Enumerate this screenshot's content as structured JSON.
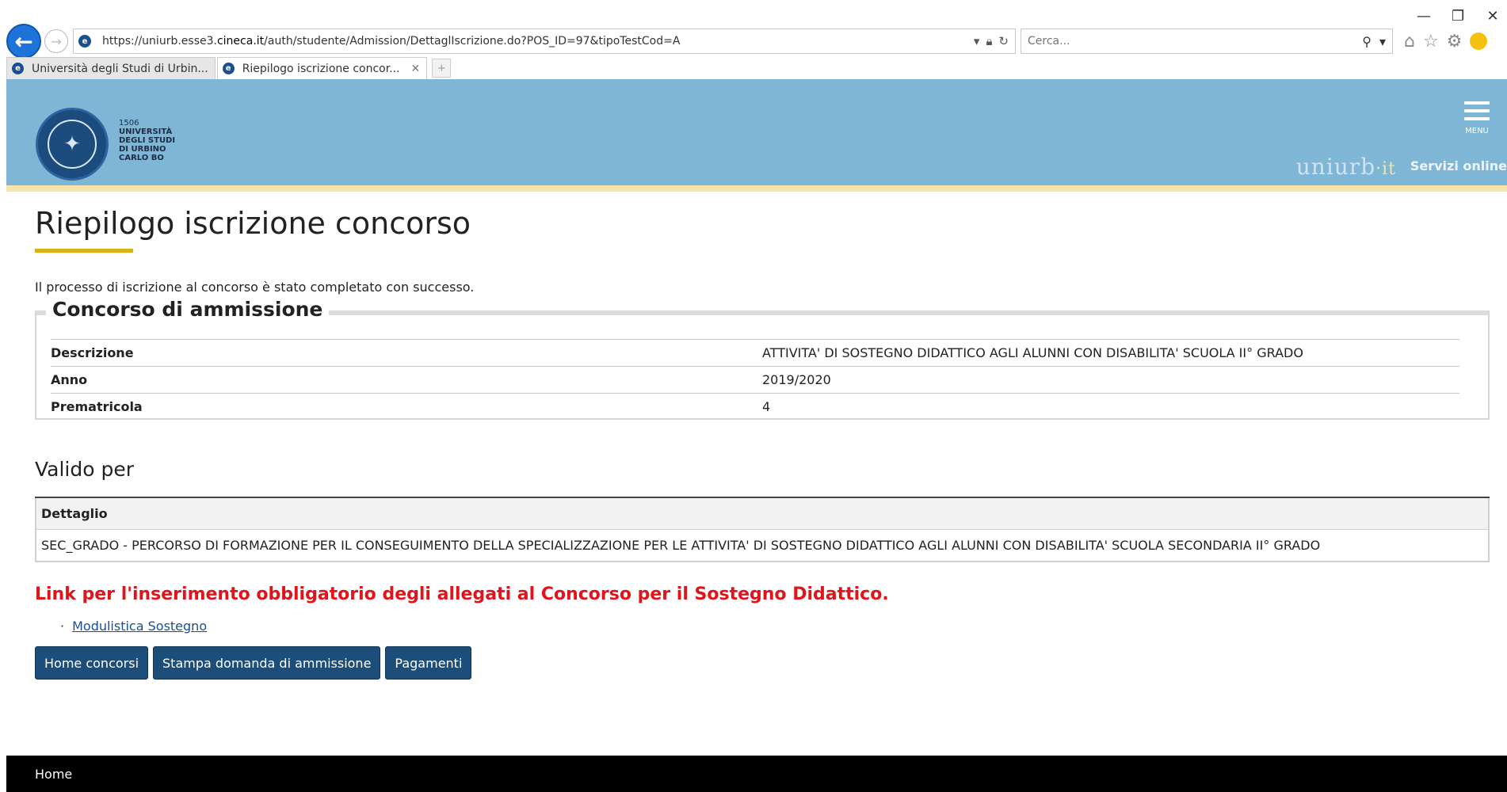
{
  "browser": {
    "url_prefix": "https://uniurb.esse3.",
    "url_domain": "cineca.it",
    "url_suffix": "/auth/studente/Admission/DettaglIscrizione.do?POS_ID=97&tipoTestCod=A",
    "search_placeholder": "Cerca...",
    "tabs": [
      {
        "label": "Università degli Studi di Urbin..."
      },
      {
        "label": "Riepilogo iscrizione concor..."
      }
    ]
  },
  "header": {
    "year": "1506",
    "uni_line1": "UNIVERSITÀ",
    "uni_line2": "DEGLI STUDI",
    "uni_line3": "DI URBINO",
    "uni_line4": "CARLO BO",
    "menu_label": "MENU",
    "brand_main": "uniurb",
    "brand_tld": "·it",
    "servizi": "Servizi online"
  },
  "main": {
    "title": "Riepilogo iscrizione concorso",
    "success_message": "Il processo di iscrizione al concorso è stato completato con successo.",
    "concorso": {
      "legend": "Concorso di ammissione",
      "rows": [
        {
          "key": "Descrizione",
          "value": "ATTIVITA' DI SOSTEGNO DIDATTICO AGLI ALUNNI CON DISABILITA' SCUOLA II° GRADO"
        },
        {
          "key": "Anno",
          "value": "2019/2020"
        },
        {
          "key": "Prematricola",
          "value": "4"
        }
      ]
    },
    "valido": {
      "title": "Valido per",
      "header": "Dettaglio",
      "row": "SEC_GRADO - PERCORSO DI FORMAZIONE PER IL CONSEGUIMENTO DELLA SPECIALIZZAZIONE PER LE ATTIVITA' DI SOSTEGNO DIDATTICO AGLI ALUNNI CON DISABILITA' SCUOLA SECONDARIA II° GRADO"
    },
    "allegati_title": "Link per l'inserimento obbligatorio degli allegati al Concorso per il Sostegno Didattico.",
    "allegati_link": "Modulistica Sostegno",
    "buttons": {
      "home": "Home concorsi",
      "stampa": "Stampa domanda di ammissione",
      "pagamenti": "Pagamenti"
    }
  },
  "footer": {
    "home": "Home"
  },
  "colors": {
    "header_bg": "#7fb6d5",
    "accent_yellow": "#d9b216",
    "button_bg": "#1c4e79",
    "alert_red": "#e0141b",
    "footer_bg": "#000000"
  }
}
